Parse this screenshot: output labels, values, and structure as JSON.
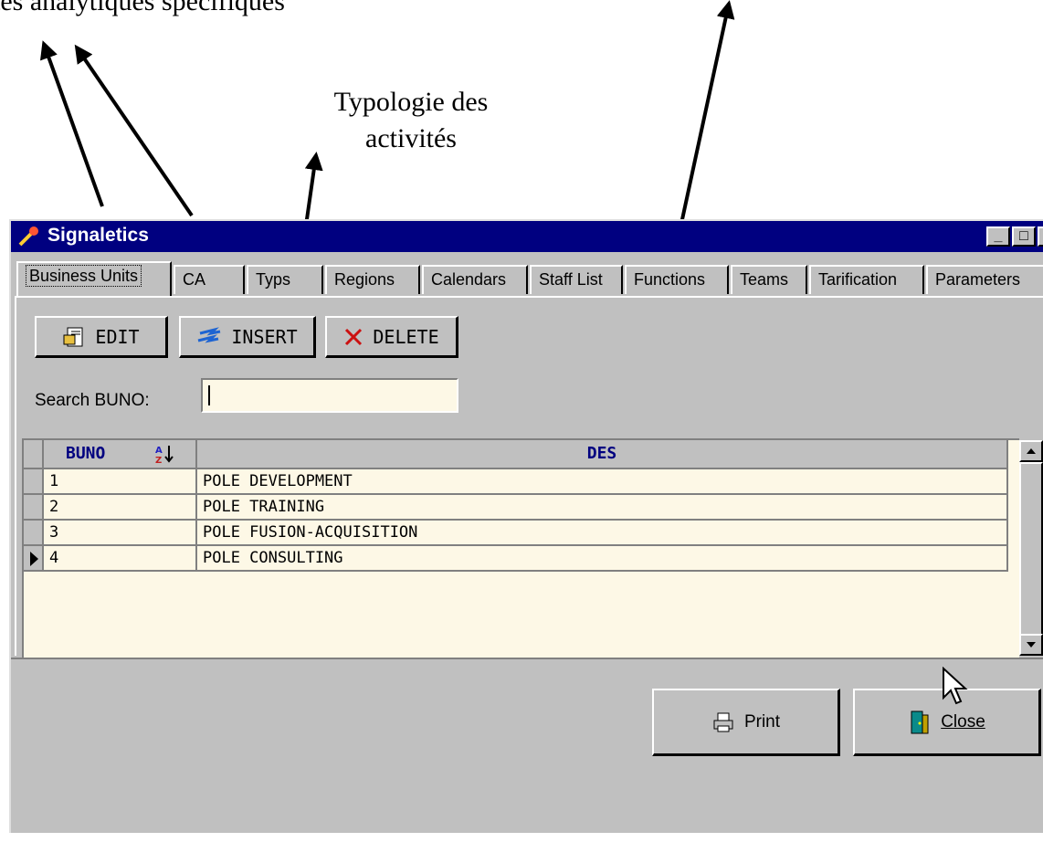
{
  "annotations": {
    "top_left": "tes analytiques spécifiques",
    "middle": "Typologie des activités"
  },
  "window": {
    "title": "Signaletics",
    "controls": [
      "_",
      "□",
      "×"
    ]
  },
  "tabs": [
    {
      "label": "Business Units",
      "active": true
    },
    {
      "label": "CA"
    },
    {
      "label": "Typs"
    },
    {
      "label": "Regions"
    },
    {
      "label": "Calendars"
    },
    {
      "label": "Staff List"
    },
    {
      "label": "Functions"
    },
    {
      "label": "Teams"
    },
    {
      "label": "Tarification"
    },
    {
      "label": "Parameters"
    }
  ],
  "toolbar": {
    "edit_label": "EDIT",
    "insert_label": "INSERT",
    "delete_label": "DELETE"
  },
  "search": {
    "label": "Search BUNO:",
    "value": ""
  },
  "grid": {
    "columns": [
      "BUNO",
      "DES"
    ],
    "sort_icon": "sort-az-icon",
    "rows": [
      {
        "buno": "1",
        "des": "POLE DEVELOPMENT"
      },
      {
        "buno": "2",
        "des": "POLE TRAINING"
      },
      {
        "buno": "3",
        "des": "POLE FUSION-ACQUISITION"
      },
      {
        "buno": "4",
        "des": "POLE CONSULTING",
        "current": true
      }
    ]
  },
  "footer": {
    "print_label": "Print",
    "close_label": "Close"
  },
  "colors": {
    "titlebar": "#000080",
    "grid_bg": "#fdf8e6",
    "face": "#c0c0c0",
    "header_text": "#000080"
  }
}
